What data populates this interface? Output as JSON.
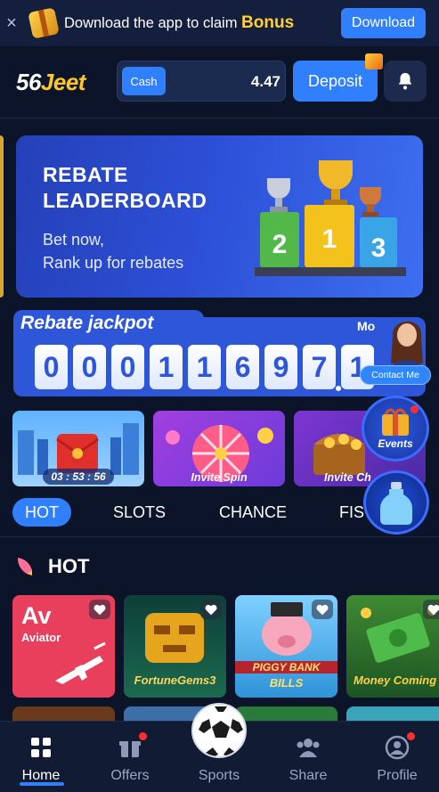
{
  "topbar": {
    "close": "×",
    "message": "Download the app to claim",
    "bonus": "Bonus",
    "download_label": "Download"
  },
  "header": {
    "logo_part1": "56",
    "logo_part2": "Jeet",
    "wallet_tag": "Cash",
    "balance": "4.47",
    "deposit_label": "Deposit"
  },
  "hero": {
    "title_line1": "REBATE",
    "title_line2": "LEADERBOARD",
    "sub_line1": "Bet now,",
    "sub_line2": "Rank up for rebates",
    "podium": [
      "2",
      "1",
      "3"
    ]
  },
  "jackpot": {
    "title": "Rebate jackpot",
    "more": "Mo",
    "digits": [
      "0",
      "0",
      "0",
      "1",
      "1",
      "6",
      "9",
      "7",
      "1"
    ],
    "contact_label": "Contact Me"
  },
  "promos": [
    {
      "label": "03 : 53 : 56"
    },
    {
      "label": "Invite Spin"
    },
    {
      "label": "Invite Ch"
    }
  ],
  "floating": {
    "events_label": "Events"
  },
  "tabs": [
    "HOT",
    "SLOTS",
    "CHANCE",
    "FIS"
  ],
  "section": {
    "title": "HOT"
  },
  "games": [
    {
      "badge": "Av",
      "name": "Aviator"
    },
    {
      "name": "FortuneGems3"
    },
    {
      "name_line1": "PIGGY BANK",
      "name_line2": "BILLS"
    },
    {
      "name": "Money Coming"
    }
  ],
  "nav": [
    {
      "label": "Home",
      "icon": "grid-icon"
    },
    {
      "label": "Offers",
      "icon": "gift-icon"
    },
    {
      "label": "Sports",
      "icon": "soccer-ball-icon"
    },
    {
      "label": "Share",
      "icon": "users-icon"
    },
    {
      "label": "Profile",
      "icon": "profile-icon"
    }
  ],
  "colors": {
    "accent": "#2f7fff",
    "background": "#0b1428",
    "bonus": "#ffd033",
    "logo_accent": "#ffc62a"
  }
}
